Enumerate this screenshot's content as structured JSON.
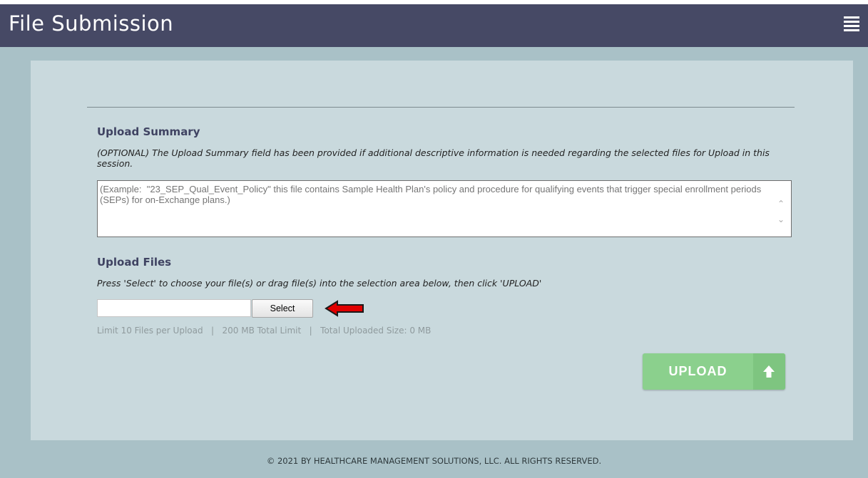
{
  "header": {
    "title": "File Submission",
    "menu_icon": "hamburger-menu-icon",
    "background": "#464965"
  },
  "upload_summary": {
    "heading": "Upload Summary",
    "note": "(OPTIONAL) The Upload Summary field has been provided if additional descriptive information is needed regarding the selected files for Upload in this session.",
    "placeholder": "(Example:  \"23_SEP_Qual_Event_Policy\" this file contains Sample Health Plan's policy and procedure for qualifying events that trigger special enrollment periods (SEPs) for on-Exchange plans.)",
    "value": ""
  },
  "upload_files": {
    "heading": "Upload Files",
    "instructions": "Press 'Select' to choose your file(s) or drag file(s) into the selection area below, then click 'UPLOAD'",
    "select_label": "Select",
    "annotation_icon": "red-arrow-icon",
    "limits_text": "Limit 10 Files per Upload   |   200 MB Total Limit   |   Total Uploaded Size: 0 MB"
  },
  "upload_button": {
    "label": "UPLOAD",
    "icon": "up-arrow-icon",
    "color": "#8bd08d"
  },
  "footer": {
    "text": "© 2021 BY HEALTHCARE MANAGEMENT SOLUTIONS, LLC. ALL RIGHTS RESERVED."
  }
}
